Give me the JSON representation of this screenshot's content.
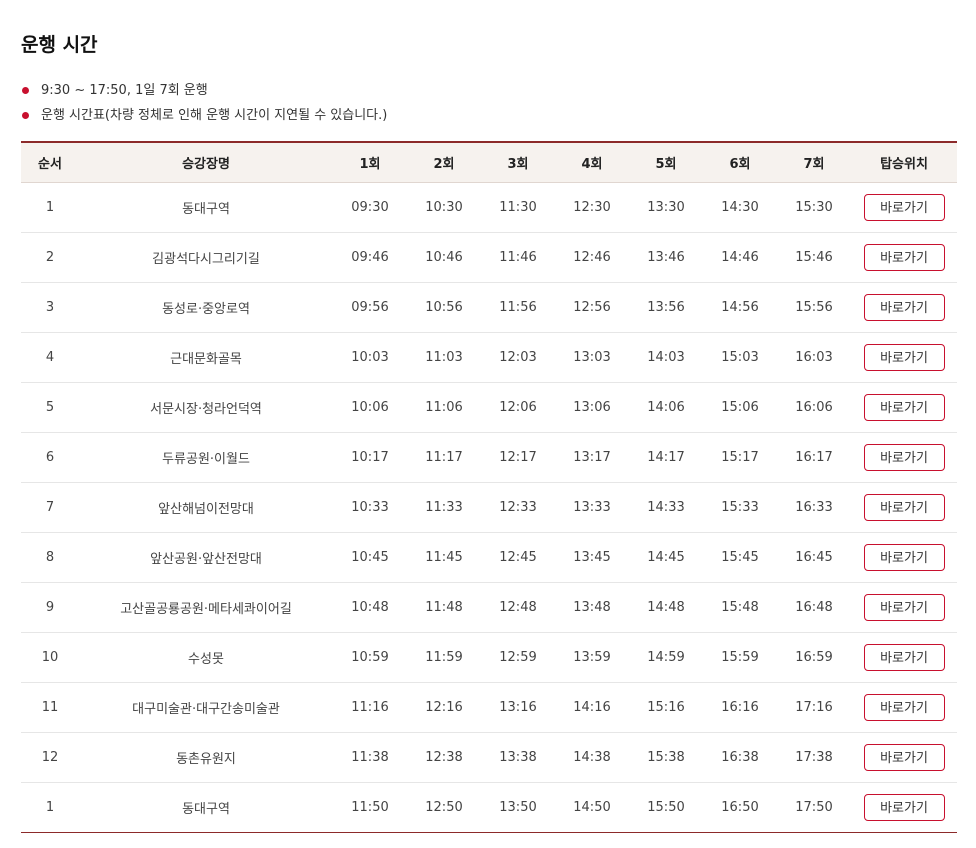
{
  "title": "운행 시간",
  "notes": [
    "9:30 ~ 17:50, 1일 7회 운행",
    "운행 시간표(차량 정체로 인해 운행 시간이 지연될 수 있습니다.)"
  ],
  "colors": {
    "accent": "#c8102e",
    "table_border": "#8c2a2a",
    "header_bg": "#f6f2ee"
  },
  "table": {
    "headers": [
      "순서",
      "승강장명",
      "1회",
      "2회",
      "3회",
      "4회",
      "5회",
      "6회",
      "7회",
      "탑승위치"
    ],
    "button_label": "바로가기",
    "rows": [
      {
        "no": "1",
        "stop": "동대구역",
        "times": [
          "09:30",
          "10:30",
          "11:30",
          "12:30",
          "13:30",
          "14:30",
          "15:30"
        ]
      },
      {
        "no": "2",
        "stop": "김광석다시그리기길",
        "times": [
          "09:46",
          "10:46",
          "11:46",
          "12:46",
          "13:46",
          "14:46",
          "15:46"
        ]
      },
      {
        "no": "3",
        "stop": "동성로·중앙로역",
        "times": [
          "09:56",
          "10:56",
          "11:56",
          "12:56",
          "13:56",
          "14:56",
          "15:56"
        ]
      },
      {
        "no": "4",
        "stop": "근대문화골목",
        "times": [
          "10:03",
          "11:03",
          "12:03",
          "13:03",
          "14:03",
          "15:03",
          "16:03"
        ]
      },
      {
        "no": "5",
        "stop": "서문시장·청라언덕역",
        "times": [
          "10:06",
          "11:06",
          "12:06",
          "13:06",
          "14:06",
          "15:06",
          "16:06"
        ]
      },
      {
        "no": "6",
        "stop": "두류공원·이월드",
        "times": [
          "10:17",
          "11:17",
          "12:17",
          "13:17",
          "14:17",
          "15:17",
          "16:17"
        ]
      },
      {
        "no": "7",
        "stop": "앞산해넘이전망대",
        "times": [
          "10:33",
          "11:33",
          "12:33",
          "13:33",
          "14:33",
          "15:33",
          "16:33"
        ]
      },
      {
        "no": "8",
        "stop": "앞산공원·앞산전망대",
        "times": [
          "10:45",
          "11:45",
          "12:45",
          "13:45",
          "14:45",
          "15:45",
          "16:45"
        ]
      },
      {
        "no": "9",
        "stop": "고산골공룡공원·메타세콰이어길",
        "times": [
          "10:48",
          "11:48",
          "12:48",
          "13:48",
          "14:48",
          "15:48",
          "16:48"
        ]
      },
      {
        "no": "10",
        "stop": "수성못",
        "times": [
          "10:59",
          "11:59",
          "12:59",
          "13:59",
          "14:59",
          "15:59",
          "16:59"
        ]
      },
      {
        "no": "11",
        "stop": "대구미술관·대구간송미술관",
        "times": [
          "11:16",
          "12:16",
          "13:16",
          "14:16",
          "15:16",
          "16:16",
          "17:16"
        ]
      },
      {
        "no": "12",
        "stop": "동촌유원지",
        "times": [
          "11:38",
          "12:38",
          "13:38",
          "14:38",
          "15:38",
          "16:38",
          "17:38"
        ]
      },
      {
        "no": "1",
        "stop": "동대구역",
        "times": [
          "11:50",
          "12:50",
          "13:50",
          "14:50",
          "15:50",
          "16:50",
          "17:50"
        ]
      }
    ]
  }
}
